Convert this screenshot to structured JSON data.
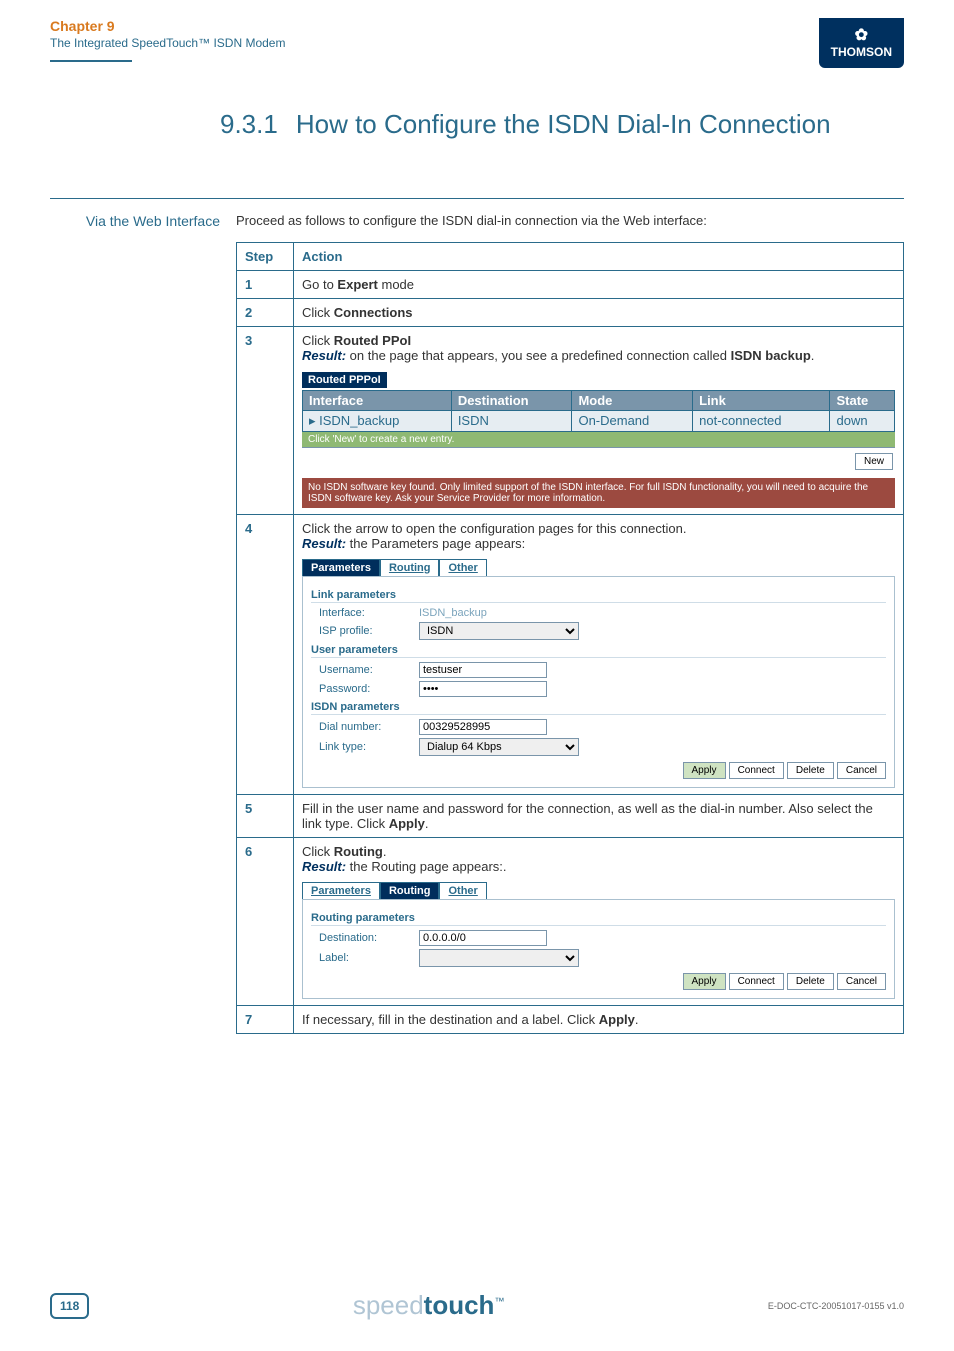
{
  "header": {
    "chapter": "Chapter 9",
    "subchapter": "The Integrated SpeedTouch™ ISDN Modem",
    "brand_icon": "✿",
    "brand_name": "THOMSON"
  },
  "title": {
    "number": "9.3.1",
    "text": "How to Configure the ISDN Dial-In Connection"
  },
  "side_label": "Via the Web Interface",
  "intro": "Proceed as follows to configure the ISDN dial-in connection via the Web interface:",
  "table_hdr": {
    "step": "Step",
    "action": "Action"
  },
  "steps": {
    "s1": {
      "num": "1",
      "pre": "Go to ",
      "bold": "Expert",
      "post": " mode"
    },
    "s2": {
      "num": "2",
      "pre": "Click ",
      "bold": "Connections"
    },
    "s3": {
      "num": "3",
      "line1_pre": "Click ",
      "line1_bold": "Routed PPoI",
      "result_label": "Result:",
      "result_text": " on the page that appears, you see a predefined connection called ",
      "result_bold": "ISDN backup",
      "result_end": ".",
      "panel_title": "Routed PPPoI",
      "cols": {
        "c1": "Interface",
        "c2": "Destination",
        "c3": "Mode",
        "c4": "Link",
        "c5": "State"
      },
      "row": {
        "c1": "ISDN_backup",
        "c2": "ISDN",
        "c3": "On-Demand",
        "c4": "not-connected",
        "c5": "down"
      },
      "newrow": "Click 'New' to create a new entry.",
      "new_btn": "New",
      "warn": "No ISDN software key found. Only limited support of the ISDN interface. For full ISDN functionality, you will need to acquire the ISDN software key. Ask your Service Provider for more information."
    },
    "s4": {
      "num": "4",
      "line1": "Click the arrow to open the configuration pages for this connection.",
      "result_label": "Result:",
      "result_text": " the Parameters page appears:",
      "tabs": {
        "t1": "Parameters",
        "t2": "Routing",
        "t3": "Other"
      },
      "sec_link": "Link parameters",
      "f_interface_l": "Interface:",
      "f_interface_v": "ISDN_backup",
      "f_isp_l": "ISP profile:",
      "f_isp_v": "ISDN",
      "sec_user": "User parameters",
      "f_user_l": "Username:",
      "f_user_v": "testuser",
      "f_pwd_l": "Password:",
      "f_pwd_v": "••••",
      "sec_isdn": "ISDN parameters",
      "f_dial_l": "Dial number:",
      "f_dial_v": "00329528995",
      "f_link_l": "Link type:",
      "f_link_v": "Dialup 64 Kbps",
      "btns": {
        "b1": "Apply",
        "b2": "Connect",
        "b3": "Delete",
        "b4": "Cancel"
      }
    },
    "s5": {
      "num": "5",
      "text_pre": "Fill in the user name and password for the connection, as well as the dial-in number. Also select the link type. Click ",
      "bold": "Apply",
      "end": "."
    },
    "s6": {
      "num": "6",
      "pre": "Click ",
      "bold": "Routing",
      "end": ".",
      "result_label": "Result:",
      "result_text": " the Routing page appears:.",
      "tabs": {
        "t1": "Parameters",
        "t2": "Routing",
        "t3": "Other"
      },
      "sec": "Routing parameters",
      "f_dest_l": "Destination:",
      "f_dest_v": "0.0.0.0/0",
      "f_label_l": "Label:",
      "f_label_v": "",
      "btns": {
        "b1": "Apply",
        "b2": "Connect",
        "b3": "Delete",
        "b4": "Cancel"
      }
    },
    "s7": {
      "num": "7",
      "pre": "If necessary, fill in the destination and a label. Click ",
      "bold": "Apply",
      "end": "."
    }
  },
  "footer": {
    "page": "118",
    "logo_pre": "speed",
    "logo_bold": "touch",
    "logo_tm": "™",
    "docref": "E-DOC-CTC-20051017-0155 v1.0"
  }
}
